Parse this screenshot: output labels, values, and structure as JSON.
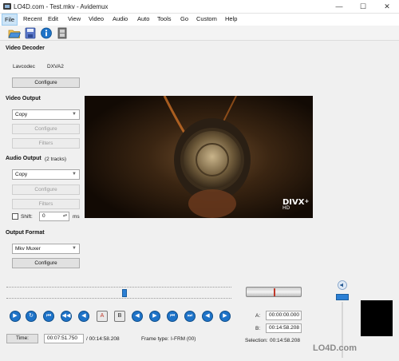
{
  "window": {
    "title": "LO4D.com - Test.mkv - Avidemux",
    "minimize": "—",
    "maximize": "☐",
    "close": "✕"
  },
  "menu": {
    "items": [
      "File",
      "Recent",
      "Edit",
      "View",
      "Video",
      "Audio",
      "Auto",
      "Tools",
      "Go",
      "Custom",
      "Help"
    ]
  },
  "toolbar": {
    "icons": [
      "open-folder-icon",
      "save-disk-icon",
      "info-icon",
      "film-strip-icon"
    ]
  },
  "video_decoder": {
    "title": "Video Decoder",
    "codec": "Lavcodec",
    "accel": "DXVA2",
    "configure": "Configure"
  },
  "video_output": {
    "title": "Video Output",
    "codec": "Copy",
    "configure": "Configure",
    "filters": "Filters"
  },
  "audio_output": {
    "title": "Audio Output",
    "tracks": "(2 tracks)",
    "codec": "Copy",
    "configure": "Configure",
    "filters": "Filters",
    "shift_label": "Shift:",
    "shift_value": "0",
    "shift_unit": "ms"
  },
  "output_format": {
    "title": "Output Format",
    "muxer": "Mkv Muxer",
    "configure": "Configure"
  },
  "video_overlay": {
    "logo_main": "DIVX",
    "logo_plus": "+",
    "logo_sub": "HD"
  },
  "timeline": {
    "position_fraction": 0.52
  },
  "status": {
    "time_button": "Time:",
    "current_time": "00:07:51.750",
    "total_time": "/ 00:14:58.208",
    "frame_type_label": "Frame type:",
    "frame_type_value": "I-FRM (00)",
    "a_label": "A:",
    "a_value": "00:00:00.000",
    "b_label": "B:",
    "b_value": "00:14:58.208",
    "selection_label": "Selection:",
    "selection_value": "00:14:58.208"
  },
  "navigation": {
    "buttons": [
      "▶",
      "↻",
      "⏮",
      "◀◀",
      "◀",
      "A",
      "B",
      "◀",
      "▶",
      "⏮",
      "⏭",
      "◀",
      "▶",
      "◀",
      "▶"
    ]
  },
  "volume": {
    "level_fraction": 0.95
  },
  "watermark": {
    "text": "LO4D.com"
  }
}
